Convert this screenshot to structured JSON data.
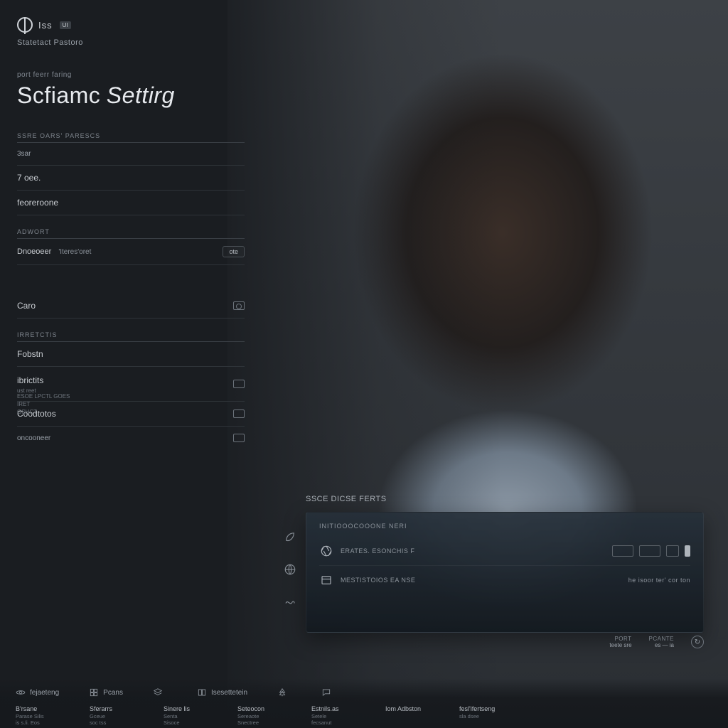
{
  "brand": {
    "name": "Iss",
    "badge": "UI",
    "subtitle": "Statetact Pastoro"
  },
  "header": {
    "eyebrow": "port feerr faring",
    "title_a": "Scfiamc",
    "title_b": "Settirg"
  },
  "settings": {
    "sec1_label": "ssre oars' parescs",
    "row1": "3sar",
    "row2_value": "7 oee.",
    "row3": "feoreroone",
    "sec2_label": "adwort",
    "row4_a": "Dnoeoeer",
    "row4_b": "'Iteres'oret",
    "row4_btn": "ote",
    "mini_stat": "ESOE LPCTL GOES\nIRET\nGSHCT",
    "row5": "Caro",
    "sec3_label": "IRRETCTIS",
    "row6": "Fobstn",
    "row7": "ibrictits",
    "row7_sub": "ust reet",
    "row8": "Coodtotos",
    "row9": "oncooneer"
  },
  "card": {
    "above_label": "SSCE DICSE FERTS",
    "sub": "INITIOOOCOOONE NERI",
    "rows": [
      {
        "icon": "aperture",
        "label": "ERATES. ESONCHIS F"
      },
      {
        "icon": "panel",
        "label": "MESTISTOIOS EA NSE",
        "right_text": "he isoor ter' cor ton"
      }
    ],
    "footer": [
      {
        "t": "PORT",
        "v": "teete sre"
      },
      {
        "t": "PCANTE",
        "v": "es — ia"
      },
      {
        "t": "",
        "v": "",
        "icon": "refresh"
      }
    ]
  },
  "side_icons": [
    "leaf",
    "globe",
    "scribble"
  ],
  "bottom": {
    "row1": [
      {
        "icon": "orbit",
        "label": "fejaeteng"
      },
      {
        "icon": "grid",
        "label": "Pcans"
      },
      {
        "icon": "layers",
        "label": ""
      },
      {
        "icon": "book",
        "label": "Isesettetein"
      },
      {
        "icon": "tree",
        "label": ""
      },
      {
        "icon": "chat",
        "label": ""
      }
    ],
    "row2": [
      {
        "h": "B'rsane",
        "s": "Parase Silis\nis s.li. Eos"
      },
      {
        "h": "Sferarrs",
        "s": "Gceue\nsoc tss"
      },
      {
        "h": "Sinere lis",
        "s": "Senta\nSisoce"
      },
      {
        "h": "Seteocon",
        "s": "Sereaote\nSnectree"
      },
      {
        "h": "Estnils.as",
        "s": "Setele\nfecsanut"
      },
      {
        "h": "Iom Adbston",
        "s": ""
      },
      {
        "h": "fesl'ifertseng",
        "s": "sla dsee"
      }
    ]
  }
}
